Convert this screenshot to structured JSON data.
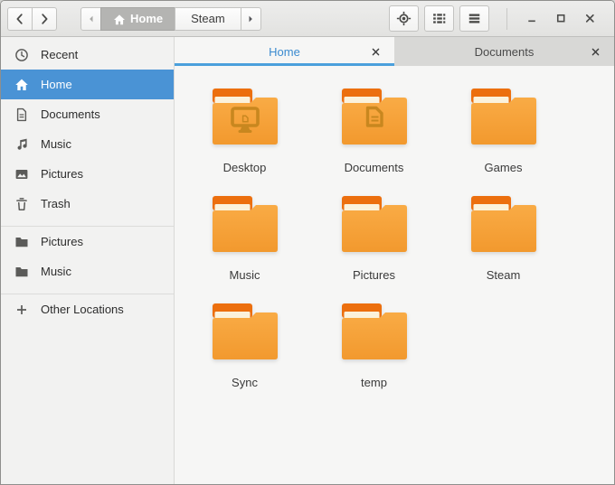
{
  "header": {
    "nav": {
      "back_icon": "chevron-left-icon",
      "forward_icon": "chevron-right-icon"
    },
    "breadcrumb": {
      "scroll_left_icon": "arrow-left-icon",
      "scroll_right_icon": "arrow-right-icon",
      "segments": [
        {
          "label": "Home",
          "icon": "home-icon",
          "current": true
        },
        {
          "label": "Steam",
          "current": false
        }
      ]
    },
    "actions": [
      {
        "name": "locate-button",
        "icon": "locate-icon"
      },
      {
        "name": "list-view-button",
        "icon": "list-view-icon"
      },
      {
        "name": "menu-button",
        "icon": "hamburger-icon"
      }
    ],
    "window_controls": [
      {
        "name": "minimize-button",
        "icon": "minimize-icon"
      },
      {
        "name": "maximize-button",
        "icon": "maximize-icon"
      },
      {
        "name": "close-button",
        "icon": "close-icon"
      }
    ]
  },
  "tabs": [
    {
      "label": "Home",
      "active": true,
      "close_icon": "close-icon"
    },
    {
      "label": "Documents",
      "active": false,
      "close_icon": "close-icon"
    }
  ],
  "sidebar": {
    "groups": [
      {
        "items": [
          {
            "label": "Recent",
            "icon": "clock-icon",
            "selected": false
          },
          {
            "label": "Home",
            "icon": "home-icon",
            "selected": true
          },
          {
            "label": "Documents",
            "icon": "document-icon",
            "selected": false
          },
          {
            "label": "Music",
            "icon": "music-note-icon",
            "selected": false
          },
          {
            "label": "Pictures",
            "icon": "image-icon",
            "selected": false
          },
          {
            "label": "Trash",
            "icon": "trash-icon",
            "selected": false
          }
        ]
      },
      {
        "items": [
          {
            "label": "Pictures",
            "icon": "folder-icon",
            "selected": false
          },
          {
            "label": "Music",
            "icon": "folder-icon",
            "selected": false
          }
        ]
      },
      {
        "items": [
          {
            "label": "Other Locations",
            "icon": "plus-icon",
            "selected": false
          }
        ]
      }
    ]
  },
  "folders": [
    {
      "name": "Desktop",
      "emblem": "monitor"
    },
    {
      "name": "Documents",
      "emblem": "document"
    },
    {
      "name": "Games",
      "emblem": null
    },
    {
      "name": "Music",
      "emblem": null
    },
    {
      "name": "Pictures",
      "emblem": null
    },
    {
      "name": "Steam",
      "emblem": null
    },
    {
      "name": "Sync",
      "emblem": null
    },
    {
      "name": "temp",
      "emblem": null
    }
  ],
  "colors": {
    "selection_blue": "#4a93d5",
    "tab_accent_blue": "#4ba0dc",
    "tab_text_blue": "#3b8bd0",
    "folder_body": "#f6a53c",
    "folder_flap": "#ec6f0e",
    "folder_stripe": "#fbf2dc",
    "folder_emblem": "#c8871f",
    "header_bg": "#e8e8e7",
    "sidebar_bg": "#f2f2f1",
    "content_bg": "#f6f6f5"
  }
}
